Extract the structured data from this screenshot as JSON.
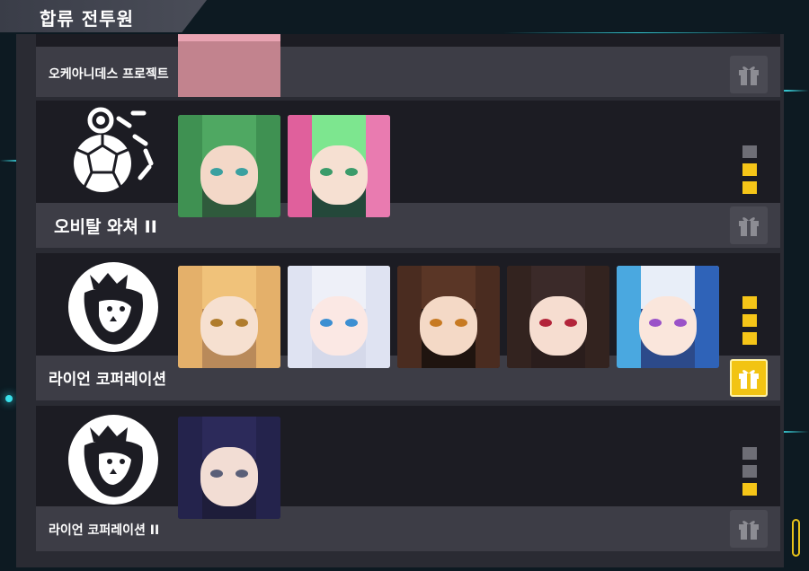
{
  "screen": {
    "title": "합류 전투원"
  },
  "groups": [
    {
      "name": "오케아니데스 프로젝트",
      "pips": [],
      "gift_state": "locked"
    },
    {
      "name": "오비탈 와쳐 II",
      "pips": [
        "off",
        "on",
        "on"
      ],
      "gift_state": "locked"
    },
    {
      "name": "라이언 코퍼레이션",
      "pips": [
        "on",
        "on",
        "on"
      ],
      "gift_state": "available"
    },
    {
      "name": "라이언 코퍼레이션 II",
      "pips": [
        "off",
        "off",
        "on"
      ],
      "gift_state": "locked"
    }
  ],
  "icons": {
    "gift": "gift-icon",
    "orbital_logo": "orbital-watcher-logo-icon",
    "lion_logo": "lion-corporation-logo-icon"
  },
  "colors": {
    "pip_on": "#f5c518",
    "pip_off": "#6e6e76",
    "gift_active": "#f2c413",
    "accent_cyan": "#39e0ea"
  }
}
